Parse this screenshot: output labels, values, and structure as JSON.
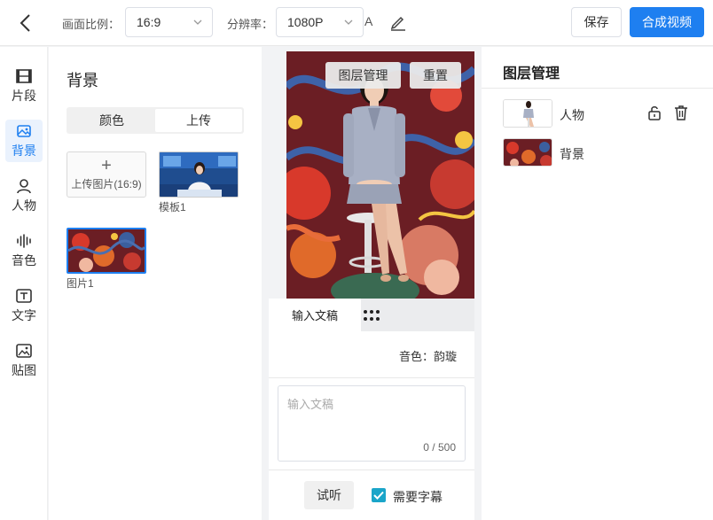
{
  "toolbar": {
    "aspect_label": "画面比例：",
    "aspect_value": "16:9",
    "resolution_label": "分辨率：",
    "resolution_value": "1080P",
    "font_a": "A",
    "save": "保存",
    "compose": "合成视频"
  },
  "nav": {
    "items": [
      {
        "label": "片段",
        "icon": "film-icon"
      },
      {
        "label": "背景",
        "icon": "background-icon",
        "active": true
      },
      {
        "label": "人物",
        "icon": "person-icon"
      },
      {
        "label": "音色",
        "icon": "voice-wave-icon"
      },
      {
        "label": "文字",
        "icon": "text-icon"
      },
      {
        "label": "贴图",
        "icon": "image-sticker-icon"
      }
    ]
  },
  "background_panel": {
    "title": "背景",
    "tabs": [
      "颜色",
      "上传"
    ],
    "active_tab": "上传",
    "upload_plus": "+",
    "upload_label": "上传图片(16:9)",
    "items": [
      {
        "caption": "模板1"
      },
      {
        "caption": "图片1",
        "selected": true
      }
    ]
  },
  "stage": {
    "layer_mgmt_btn": "图层管理",
    "reset_btn": "重置"
  },
  "script": {
    "tab_label": "输入文稿",
    "voice_line": "音色：韵璇",
    "placeholder": "输入文稿",
    "counter": "0 / 500",
    "listen_btn": "试听",
    "subtitle_label": "需要字幕",
    "subtitle_checked": true
  },
  "layers": {
    "title": "图层管理",
    "items": [
      {
        "name": "人物"
      },
      {
        "name": "背景"
      }
    ]
  },
  "colors": {
    "primary": "#1e7ff0",
    "checkbox": "#1aa5c9"
  }
}
